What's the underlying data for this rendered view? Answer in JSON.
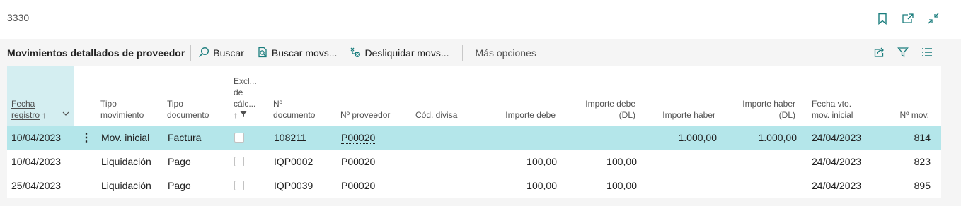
{
  "page": {
    "title": "3330"
  },
  "actionbar": {
    "section_title": "Movimientos detallados de proveedor",
    "search_label": "Buscar",
    "find_entries_label": "Buscar movs...",
    "unapply_label": "Desliquidar movs...",
    "more_label": "Más opciones"
  },
  "columns": {
    "fecha_registro_1": "Fecha",
    "fecha_registro_2": "registro",
    "sort_arrow": "↑",
    "tipo_mov_1": "Tipo",
    "tipo_mov_2": "movimiento",
    "tipo_doc_1": "Tipo",
    "tipo_doc_2": "documento",
    "excl_1": "Excl...",
    "excl_2": "de",
    "excl_3": "cálc...",
    "excl_4": "↑",
    "n_doc_1": "Nº",
    "n_doc_2": "documento",
    "n_proveedor": "Nº proveedor",
    "cod_divisa": "Cód. divisa",
    "importe_debe": "Importe debe",
    "importe_debe_dl_1": "Importe debe",
    "importe_debe_dl_2": "(DL)",
    "importe_haber": "Importe haber",
    "importe_haber_dl_1": "Importe haber",
    "importe_haber_dl_2": "(DL)",
    "fecha_vto_1": "Fecha vto.",
    "fecha_vto_2": "mov. inicial",
    "n_mov": "Nº mov."
  },
  "rows": [
    {
      "fecha": "10/04/2023",
      "tipo_mov": "Mov. inicial",
      "tipo_doc": "Factura",
      "excl": false,
      "n_doc": "108211",
      "proveedor": "P00020",
      "divisa": "",
      "debe": "",
      "debe_dl": "",
      "haber": "1.000,00",
      "haber_dl": "1.000,00",
      "fecha_vto": "24/04/2023",
      "n_mov": "814"
    },
    {
      "fecha": "10/04/2023",
      "tipo_mov": "Liquidación",
      "tipo_doc": "Pago",
      "excl": false,
      "n_doc": "IQP0002",
      "proveedor": "P00020",
      "divisa": "",
      "debe": "100,00",
      "debe_dl": "100,00",
      "haber": "",
      "haber_dl": "",
      "fecha_vto": "24/04/2023",
      "n_mov": "823"
    },
    {
      "fecha": "25/04/2023",
      "tipo_mov": "Liquidación",
      "tipo_doc": "Pago",
      "excl": false,
      "n_doc": "IQP0039",
      "proveedor": "P00020",
      "divisa": "",
      "debe": "100,00",
      "debe_dl": "100,00",
      "haber": "",
      "haber_dl": "",
      "fecha_vto": "24/04/2023",
      "n_mov": "895"
    }
  ],
  "colors": {
    "accent": "#1a7d7d",
    "selected_row": "#b4e6ea",
    "sorted_header": "#d4eef1"
  },
  "icons": [
    "bookmark-icon",
    "open-new-window-icon",
    "collapse-icon",
    "search-icon",
    "find-entries-icon",
    "unapply-icon",
    "share-icon",
    "filter-icon",
    "list-view-icon",
    "row-menu-icon",
    "chevron-down-icon"
  ]
}
